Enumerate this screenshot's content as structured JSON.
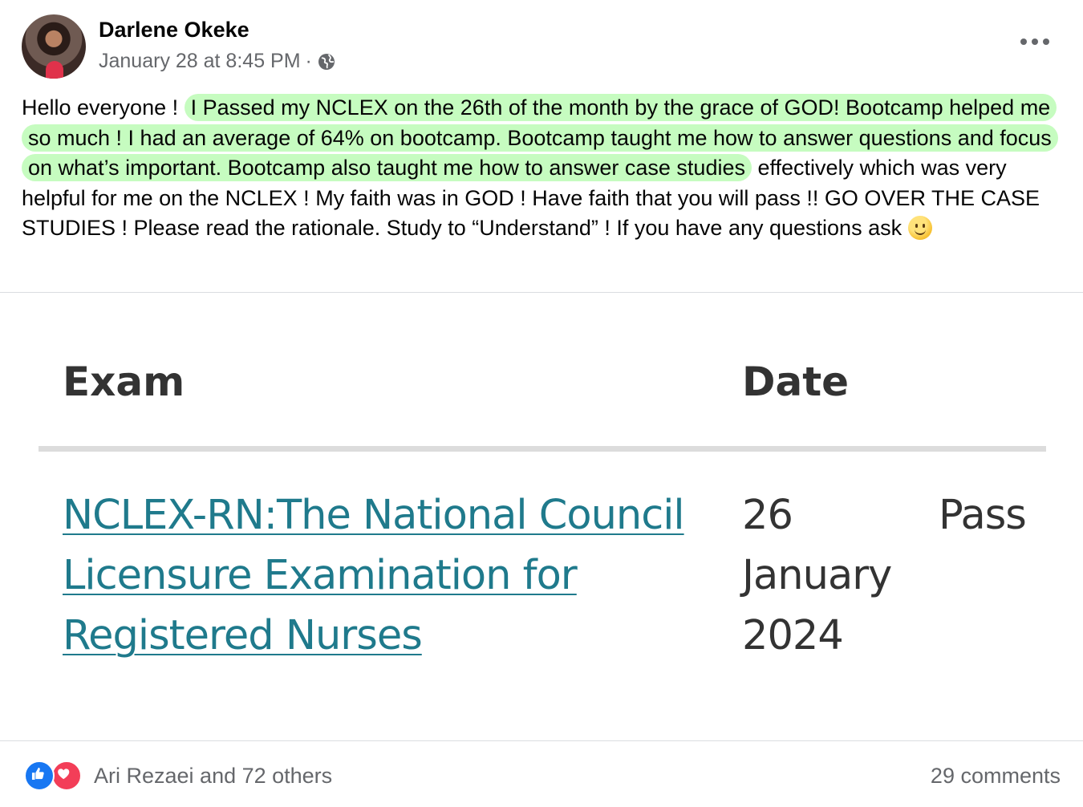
{
  "post": {
    "author": "Darlene Okeke",
    "timestamp": "January 28 at 8:45 PM",
    "separator": "·",
    "privacy_icon": "globe-icon",
    "text_before": "Hello everyone !",
    "text_highlight": "I Passed my NCLEX on the 26th of the month by the grace of GOD! Bootcamp helped me so much ! I had an average of 64% on bootcamp. Bootcamp taught me how to answer questions and focus on what’s important. Bootcamp also taught me how to answer case studies",
    "text_after": "effectively which was very helpful for me on the NCLEX ! My faith was in GOD ! Have faith that you will pass !! GO OVER THE CASE STUDIES ! Please read the rationale. Study to “Understand” ! If you have any questions ask",
    "emoji": "slightly-smiling-face-icon",
    "highlight_color": "#c6fcc0"
  },
  "attachment": {
    "headers": {
      "exam": "Exam",
      "date": "Date"
    },
    "row": {
      "exam": "NCLEX-RN:The National Council Licensure Examination for Registered Nurses",
      "date_day": "26",
      "date_month": "January",
      "date_year": "2024",
      "result": "Pass"
    },
    "link_color": "#1f7a8c"
  },
  "footer": {
    "reaction_icons": [
      "like-icon",
      "love-icon"
    ],
    "reactions_label": "Ari Rezaei and 72 others",
    "comments_label": "29 comments"
  }
}
